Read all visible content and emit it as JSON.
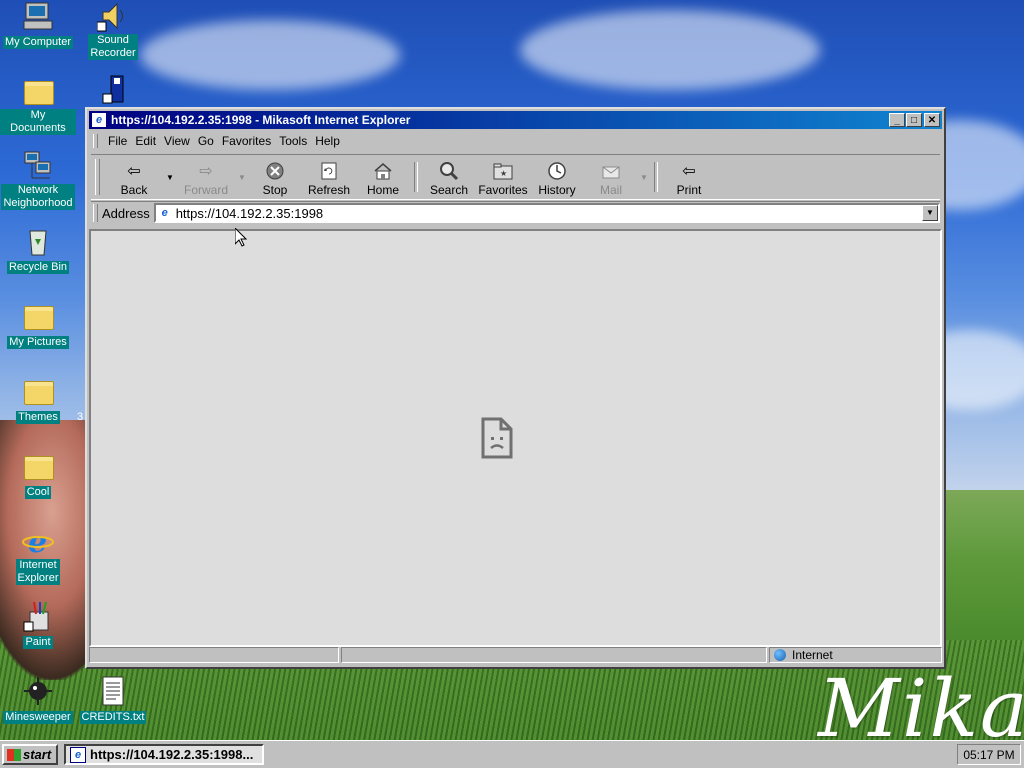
{
  "desktop": {
    "icons": [
      {
        "label": "My Computer",
        "icon": "my-computer-icon"
      },
      {
        "label": "Sound\nRecorder",
        "icon": "sound-recorder-icon"
      },
      {
        "label": "My Documents",
        "icon": "folder-icon"
      },
      {
        "label": "Network\nNeighborhood",
        "icon": "network-icon"
      },
      {
        "label": "Recycle Bin",
        "icon": "recycle-bin-icon"
      },
      {
        "label": "My Pictures",
        "icon": "folder-icon"
      },
      {
        "label": "Themes",
        "icon": "folder-icon"
      },
      {
        "label": "Cool",
        "icon": "folder-icon"
      },
      {
        "label": "Internet\nExplorer",
        "icon": "ie-icon"
      },
      {
        "label": "Paint",
        "icon": "paint-icon"
      },
      {
        "label": "Minesweeper",
        "icon": "minesweeper-icon"
      },
      {
        "label": "CREDITS.txt",
        "icon": "text-file-icon"
      }
    ],
    "wallpaper_text": "Mikas",
    "partial_label_char": "3"
  },
  "window": {
    "title": "https://104.192.2.35:1998 - Mikasoft Internet Explorer",
    "controls": {
      "minimize": "_",
      "maximize": "□",
      "close": "✕"
    },
    "menu": [
      "File",
      "Edit",
      "View",
      "Go",
      "Favorites",
      "Tools",
      "Help"
    ],
    "toolbar": {
      "back": "Back",
      "forward": "Forward",
      "stop": "Stop",
      "refresh": "Refresh",
      "home": "Home",
      "search": "Search",
      "favorites": "Favorites",
      "history": "History",
      "mail": "Mail",
      "print": "Print"
    },
    "address": {
      "label": "Address",
      "value": "https://104.192.2.35:1998"
    },
    "status": {
      "zone": "Internet"
    }
  },
  "taskbar": {
    "start": "start",
    "task": "https://104.192.2.35:1998...",
    "clock": "05:17 PM"
  },
  "colors": {
    "title_start": "#000080",
    "title_end": "#1084d0",
    "chrome": "#c0c0c0",
    "icon_label_bg": "#008080"
  }
}
